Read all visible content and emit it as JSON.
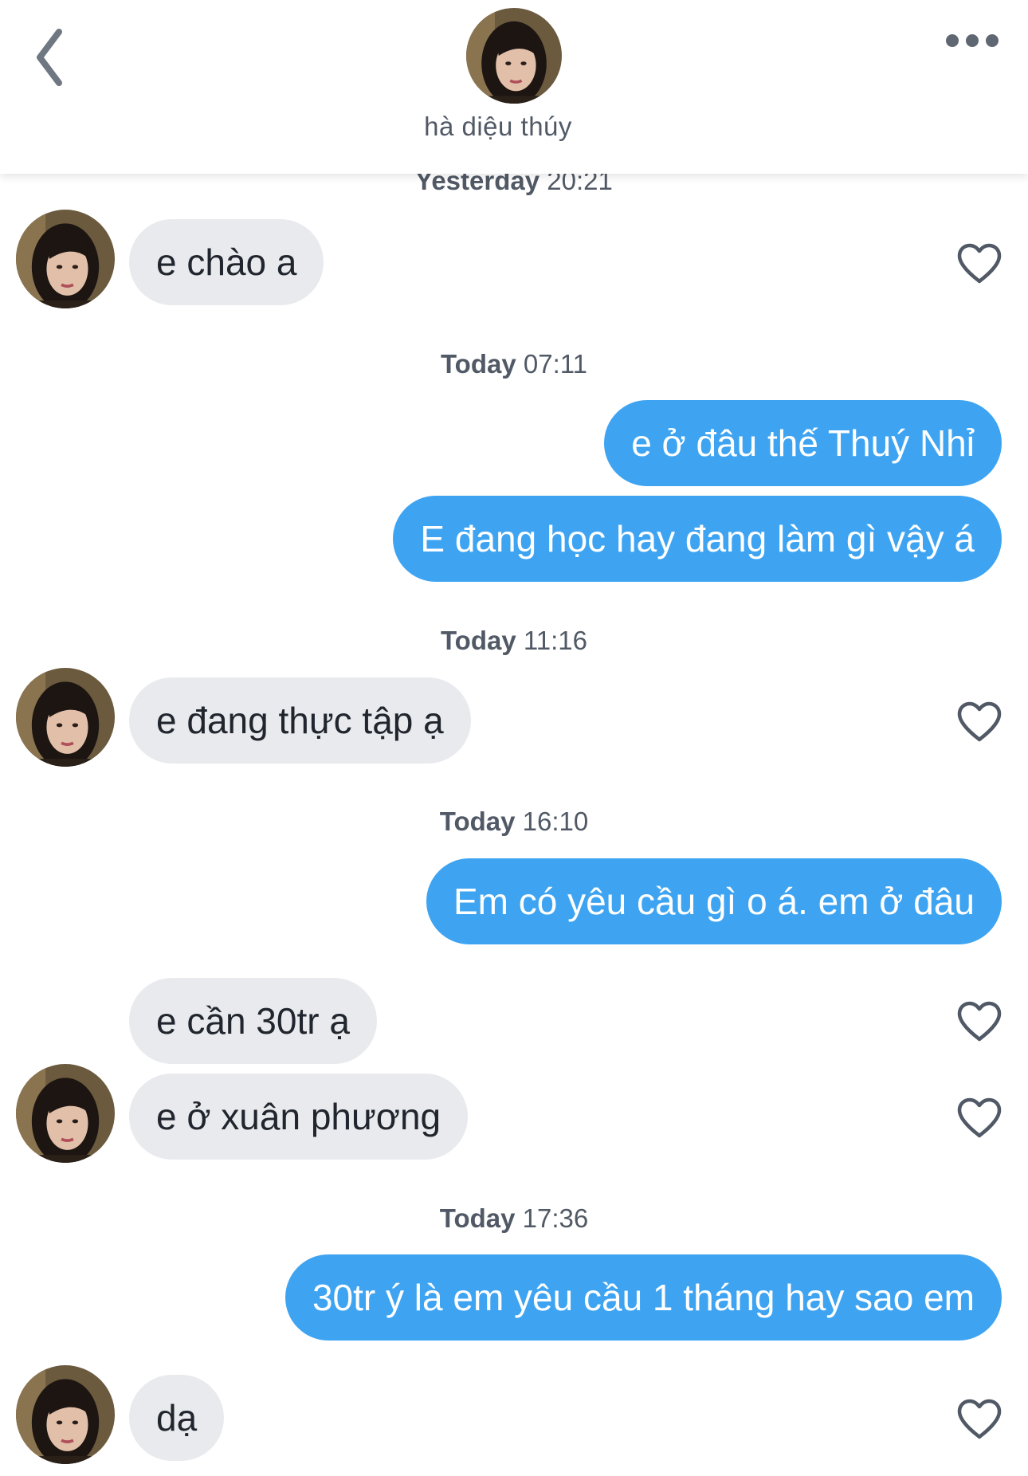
{
  "header": {
    "name": "hà diệu thúy",
    "back_icon": "chevron-left-icon",
    "more_icon": "more-horizontal-icon"
  },
  "colors": {
    "outgoing_bubble": "#3ea4f2",
    "incoming_bubble": "#e9eaee",
    "text_muted": "#505965"
  },
  "thread": {
    "ts_yesterday_2021": {
      "day": "Yesterday",
      "time": "20:21"
    },
    "msg_1": "e chào a",
    "ts_today_0711": {
      "day": "Today",
      "time": "07:11"
    },
    "msg_2": "e ở đâu thế Thuý Nhỉ",
    "msg_3": "E đang học hay đang làm gì vậy á",
    "ts_today_1116": {
      "day": "Today",
      "time": "11:16"
    },
    "msg_4": "e đang thực tập ạ",
    "ts_today_1610": {
      "day": "Today",
      "time": "16:10"
    },
    "msg_5": "Em có yêu cầu gì o á.  em ở đâu",
    "msg_6": "e cần 30tr ạ",
    "msg_7": "e ở xuân phương",
    "ts_today_1736": {
      "day": "Today",
      "time": "17:36"
    },
    "msg_8": "30tr ý là em yêu cầu 1 tháng hay sao em",
    "msg_9": "dạ"
  }
}
